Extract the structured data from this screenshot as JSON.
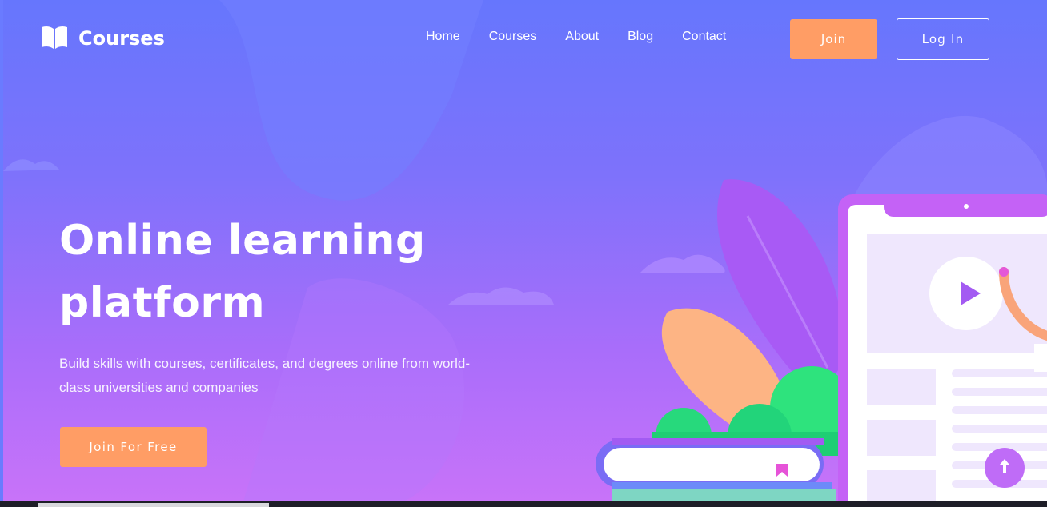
{
  "header": {
    "logo_icon": "book-open-icon",
    "brand": "Courses",
    "nav": [
      {
        "label": "Home"
      },
      {
        "label": "Courses"
      },
      {
        "label": "About"
      },
      {
        "label": "Blog"
      },
      {
        "label": "Contact"
      }
    ],
    "join_label": "Join",
    "login_label": "Log In"
  },
  "hero": {
    "title_line1": "Online learning",
    "title_line2": "platform",
    "subtitle_line1": "Build skills with courses, certificates, and degrees online from world-",
    "subtitle_line2": "class universities and companies",
    "cta_label": "Join For Free"
  },
  "scroll_top_icon": "arrow-up-icon",
  "colors": {
    "accent_orange": "#ff9d65",
    "gradient_top": "#6676fd",
    "gradient_bottom": "#c873f9",
    "scroll_button": "#bf6cf7"
  }
}
